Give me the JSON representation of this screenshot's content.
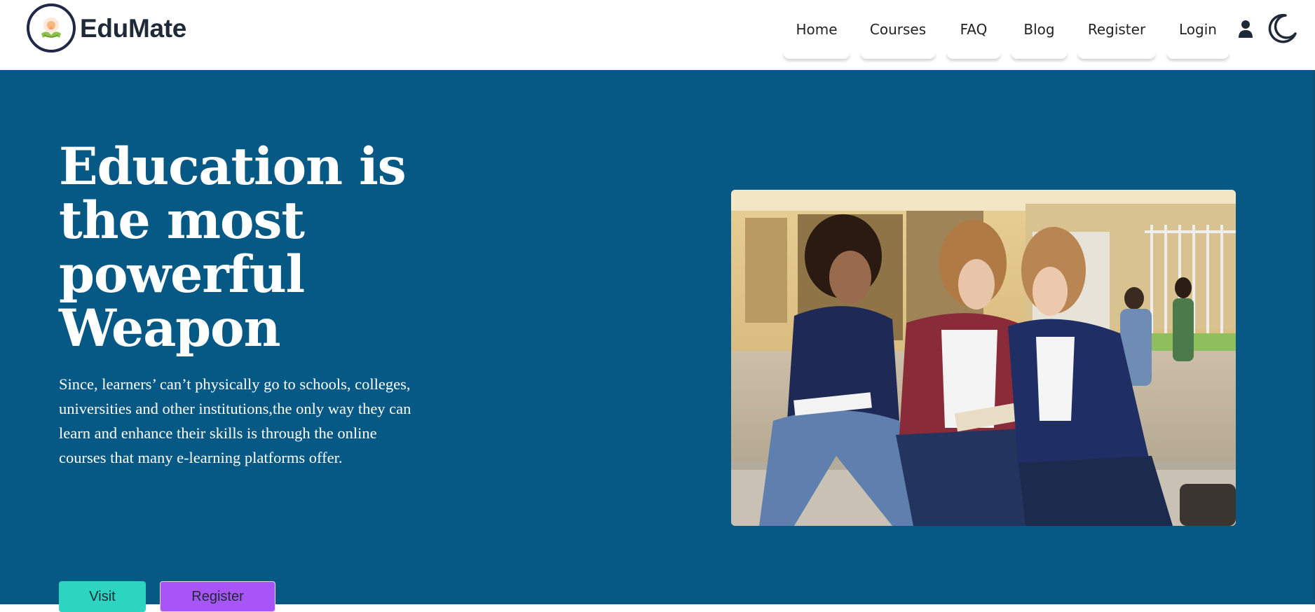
{
  "brand": {
    "name": "EduMate",
    "logo_icon": "lotus-book-logo-icon"
  },
  "nav": {
    "links": [
      {
        "label": "Home"
      },
      {
        "label": "Courses"
      },
      {
        "label": "FAQ"
      },
      {
        "label": "Blog"
      },
      {
        "label": "Register"
      },
      {
        "label": "Login"
      }
    ],
    "user_icon": "user-icon",
    "theme_icon": "moon-icon"
  },
  "hero": {
    "headline_lines": [
      "Education is",
      "the most",
      "powerful",
      "Weapon"
    ],
    "subtext_lines": [
      "Since, learners’ can’t physically go to schools, colleges,",
      "universities and other institutions,the only way they can",
      "learn and enhance their skills is through the online",
      "courses that many e-learning platforms offer."
    ],
    "buttons": {
      "visit": "Visit",
      "register": "Register"
    },
    "image_subject": "students-studying-outdoors-photo"
  },
  "colors": {
    "hero_bg": "#075985",
    "visit_button": "#2dd4bf",
    "register_button": "#a855f7",
    "brand_text": "#1f2937",
    "logo_ring": "#222848"
  }
}
